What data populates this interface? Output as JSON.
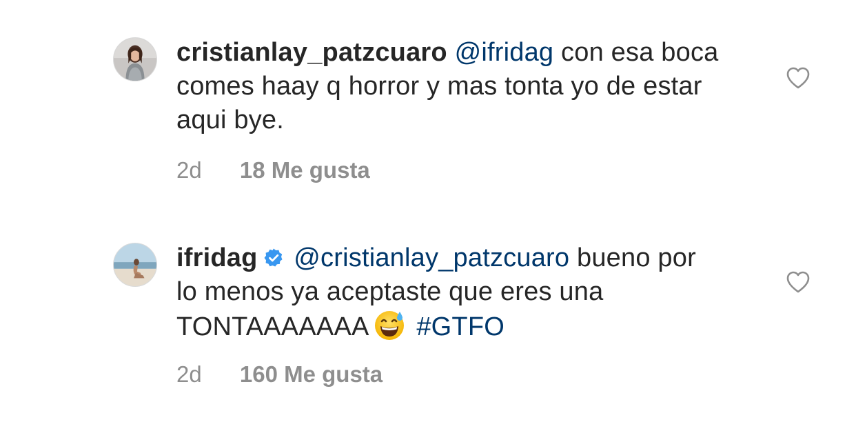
{
  "comments": [
    {
      "username": "cristianlay_patzcuaro",
      "mention": "@ifridag",
      "text": " con esa boca comes haay q horror y mas tonta yo de estar aqui bye.",
      "time": "2d",
      "likes": "18 Me gusta",
      "verified": false
    },
    {
      "username": "ifridag",
      "mention": "@cristianlay_patzcuaro",
      "text": "bueno por lo menos ya aceptaste que eres una TONTAAAAAAA",
      "emoji": "grinning-face-with-sweat",
      "hashtag": "#GTFO",
      "time": "2d",
      "likes": "160 Me gusta",
      "verified": true
    }
  ],
  "colors": {
    "text": "#262626",
    "link": "#00376b",
    "secondary": "#8e8e8e",
    "verified_badge": "#3897f0"
  }
}
